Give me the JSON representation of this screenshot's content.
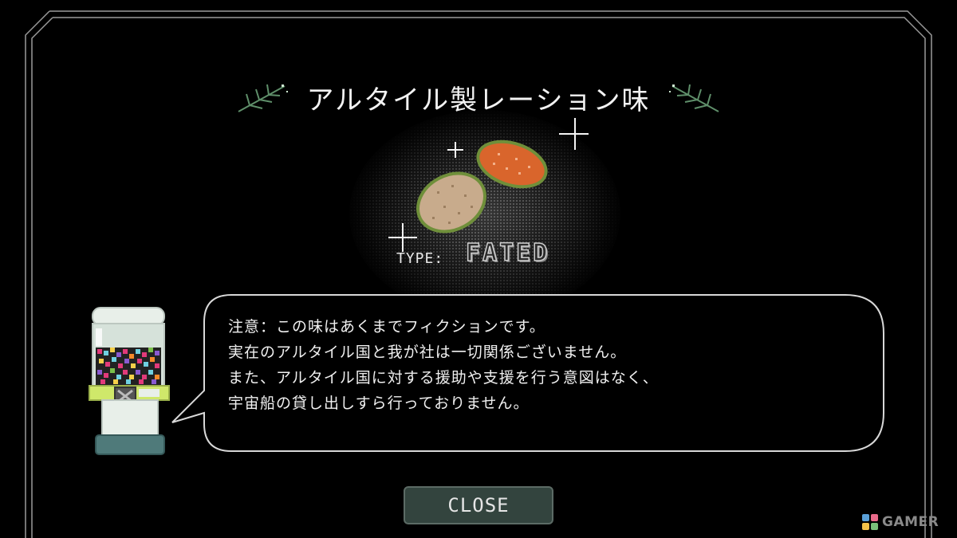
{
  "dialog": {
    "title": "アルタイル製レーション味",
    "item_type_label": "TYPE:",
    "item_type_value": "FATED",
    "message_lines": [
      "注意：この味はあくまでフィクションです。",
      "実在のアルタイル国と我が社は一切関係ございません。",
      "また、アルタイル国に対する援助や支援を行う意図はなく、",
      "宇宙船の貸し出しすら行っておりません。"
    ],
    "close_label": "CLOSE"
  },
  "watermark": {
    "text": "GAMER"
  },
  "icons": {
    "left_leaf": "leaf-sprig-icon",
    "right_leaf": "leaf-sprig-icon",
    "sparkle": "sparkle-cross-icon",
    "watermark_logo": "gamer-logo-icon"
  },
  "colors": {
    "background": "#000000",
    "frame": "#9a9a9a",
    "leaf": "#5f8f6a",
    "button_fill": "#33443e",
    "ration_tan": "#c8ab8c",
    "ration_orange": "#d9652c",
    "ration_outline": "#6f8f3a"
  }
}
